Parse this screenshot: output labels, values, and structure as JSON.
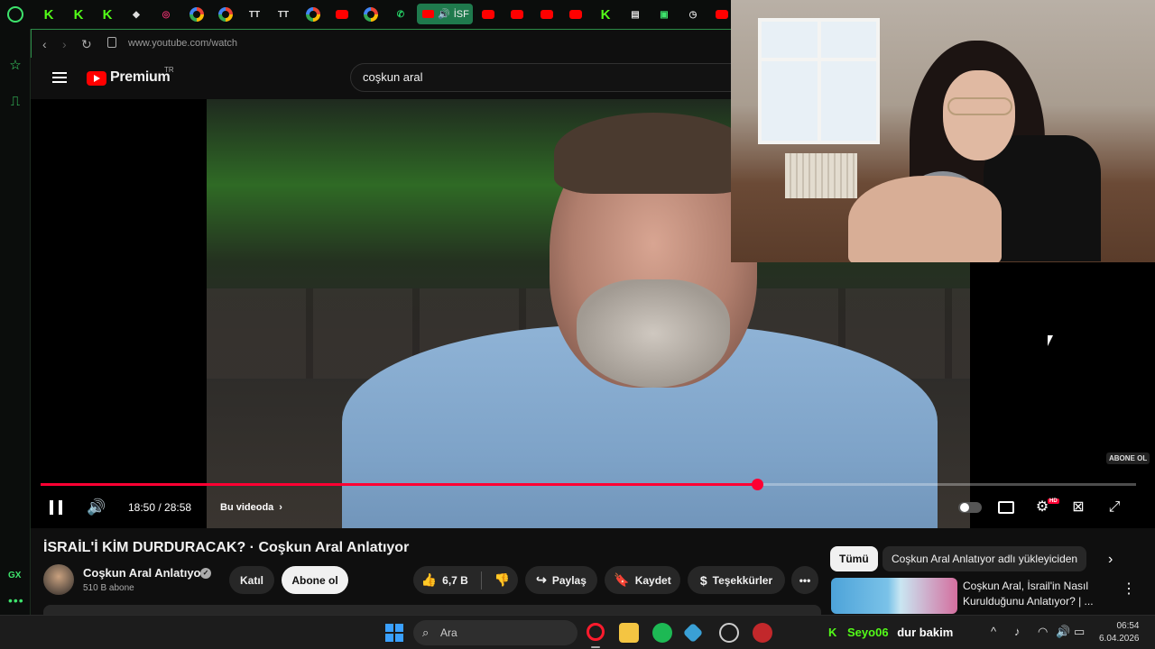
{
  "browser": {
    "url": "www.youtube.com/watch",
    "active_tab_label": "İSF",
    "sidebar_gx_label": "GX"
  },
  "youtube": {
    "brand": "Premium",
    "country": "TR",
    "search_value": "coşkun aral"
  },
  "player": {
    "current_time": "18:50",
    "duration": "28:58",
    "time_display": "18:50 / 28:58",
    "chapter_label": "Bu videoda",
    "progress_fraction": 0.654,
    "watermark": "ABONE OL",
    "hd_badge": "HD"
  },
  "video": {
    "title": "İSRAİL'İ KİM DURDURACAK? · Coşkun Aral Anlatıyor",
    "channel_name": "Coşkun Aral Anlatıyor",
    "subscribers": "510 B abone",
    "join_label": "Katıl",
    "subscribe_label": "Abone ol",
    "likes": "6,7 B",
    "share_label": "Paylaş",
    "save_label": "Kaydet",
    "thanks_label": "Teşekkürler"
  },
  "related": {
    "chips": [
      "Tümü",
      "Coşkun Aral Anlatıyor adlı yükleyiciden"
    ],
    "item_title": "Coşkun Aral, İsrail'in Nasıl Kurulduğunu Anlatıyor? | ..."
  },
  "taskbar": {
    "search_placeholder": "Ara",
    "stream_user": "Seyo06",
    "stream_message": "dur bakim",
    "time": "06:54",
    "date": "6.04.2026"
  },
  "colors": {
    "accent_red": "#ff0033",
    "opera_green": "#3ee36c",
    "kick_green": "#53fc18"
  }
}
